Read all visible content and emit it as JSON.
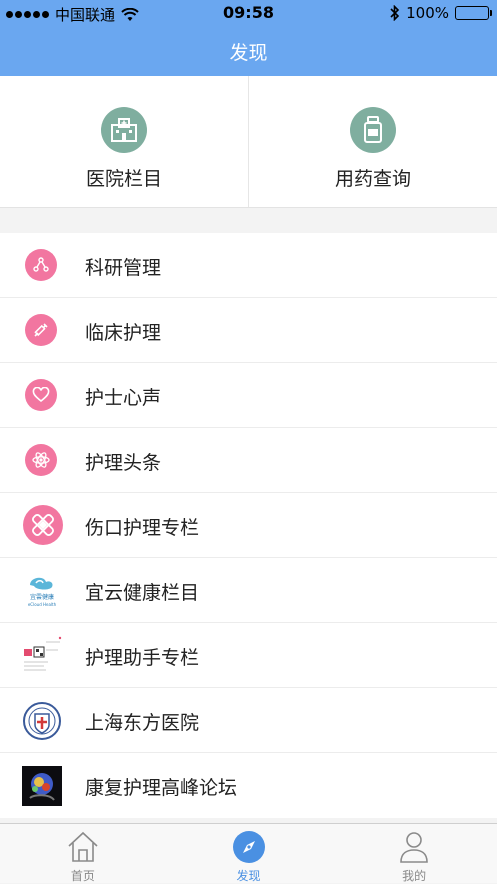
{
  "status_bar": {
    "carrier": "中国联通",
    "time": "09:58",
    "battery": "100%"
  },
  "nav": {
    "title": "发现"
  },
  "top_grid": [
    {
      "label": "医院栏目",
      "icon": "hospital-icon"
    },
    {
      "label": "用药查询",
      "icon": "medicine-bottle-icon"
    }
  ],
  "list": [
    {
      "label": "科研管理",
      "icon": "molecule-nodes-icon"
    },
    {
      "label": "临床护理",
      "icon": "syringe-icon"
    },
    {
      "label": "护士心声",
      "icon": "heart-icon"
    },
    {
      "label": "护理头条",
      "icon": "atom-icon"
    },
    {
      "label": "伤口护理专栏",
      "icon": "bandage-icon"
    },
    {
      "label": "宜云健康栏目",
      "icon": "yiyun-health-logo",
      "logo_text": "宜雲健康",
      "logo_subtext": "eCloud Health"
    },
    {
      "label": "护理助手专栏",
      "icon": "nursing-assistant-thumbnail"
    },
    {
      "label": "上海东方医院",
      "icon": "hospital-emblem"
    },
    {
      "label": "康复护理高峰论坛",
      "icon": "brain-scan-thumbnail"
    }
  ],
  "tabs": [
    {
      "label": "首页",
      "icon": "home-icon",
      "active": false
    },
    {
      "label": "发现",
      "icon": "compass-icon",
      "active": true
    },
    {
      "label": "我的",
      "icon": "person-icon",
      "active": false
    }
  ],
  "colors": {
    "nav_blue": "#6aa7f0",
    "icon_pink": "#f276a0",
    "grid_green": "#7fae9f",
    "tab_active": "#4a90e2"
  }
}
